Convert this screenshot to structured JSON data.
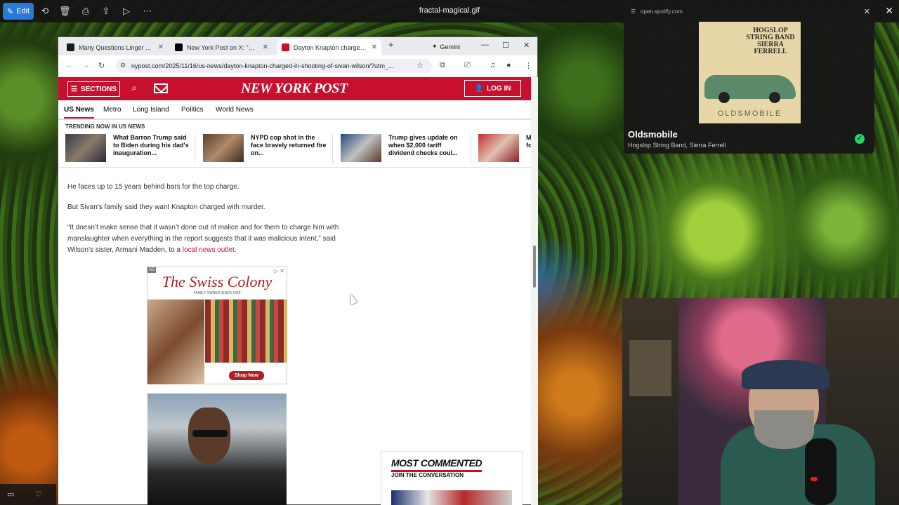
{
  "viewer": {
    "edit_label": "Edit",
    "filename": "fractal-magical.gif",
    "close": "✕"
  },
  "browser": {
    "tabs": [
      {
        "label": "Many Questions Linger After",
        "color": "#1a1a1a"
      },
      {
        "label": "New York Post on X: \"Michiga",
        "color": "#000000"
      },
      {
        "label": "Dayton Knapton charged in sl",
        "color": "#c8102e"
      }
    ],
    "new_tab": "+",
    "gemini_label": "Gemini",
    "url": "nypost.com/2025/11/16/us-news/dayton-knapton-charged-in-shooting-of-sivan-wilson/?utm_..."
  },
  "nyp": {
    "sections_label": "SECTIONS",
    "logo": "NEW YORK POST",
    "login_label": "LOG IN",
    "nav": [
      "US News",
      "Metro",
      "Long Island",
      "Politics",
      "World News"
    ],
    "trending_head": "TRENDING NOW IN US NEWS",
    "trending": [
      {
        "text": "What Barron Trump said to Biden during his dad's inauguration..."
      },
      {
        "text": "NYPD cop shot in the face bravely returned fire on..."
      },
      {
        "text": "Trump gives update on when $2,000 tariff dividend checks coul..."
      },
      {
        "text": "M fo"
      }
    ]
  },
  "article": {
    "p1": "He faces up to 15 years behind bars for the top charge.",
    "p2": "But Sivan's family said they want Knapton charged with murder.",
    "p3_start": "“It doesn’t make sense that it wasn’t done out of malice and for them to charge him with manslaughter when everything in the report suggests that it was malicious intent,” said Wilson’s sister, Armani Madden, to a ",
    "p3_link": "local news outlet",
    "p3_end": "."
  },
  "ad": {
    "badge": "AD",
    "brand": "The Swiss Colony",
    "tagline": "FAMILY OWNED SINCE 1926",
    "cta": "Shop Now"
  },
  "most_commented": {
    "title": "MOST COMMENTED",
    "subtitle": "JOIN THE CONVERSATION"
  },
  "spotify": {
    "url": "open.spotify.com",
    "album_band": "HOGSLOP STRING BAND SIERRA FERRELL",
    "album_name": "OLDSMOBILE",
    "track": "Oldsmobile",
    "artists": "Hogslop String Band, Sierra Ferrell"
  },
  "colors": {
    "nyp_red": "#c8102e",
    "spotify_green": "#1ed760",
    "edit_blue": "#2a79d8"
  }
}
